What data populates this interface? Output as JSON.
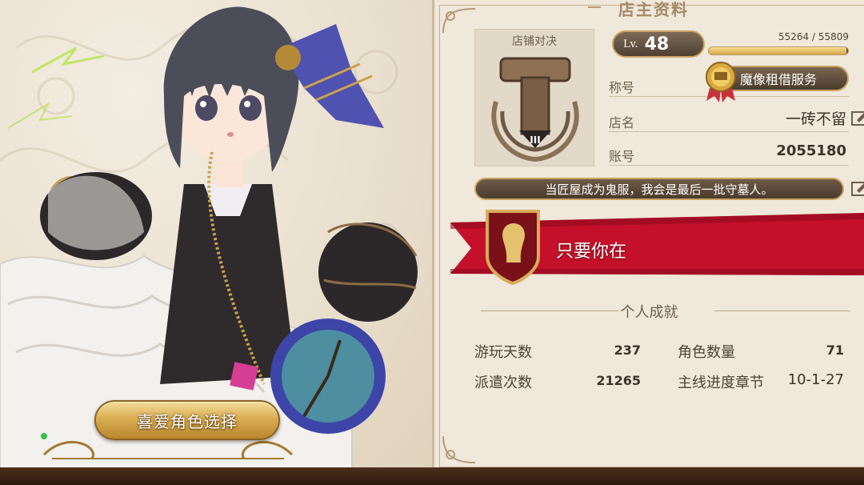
{
  "profile": {
    "panel_title": "店主资料",
    "card_title": "店铺对决",
    "rank_numeral": "III",
    "level_label": "Lv.",
    "level": "48",
    "exp_text": "55264 / 55809",
    "exp_fraction": 0.99,
    "title_label": "称号",
    "service_label": "魔像租借服务",
    "shop_name_label": "店名",
    "shop_name": "一砖不留",
    "account_label": "账号",
    "account": "2055180",
    "motto": "当匠屋成为鬼服，我会是最后一批守墓人。",
    "ribbon_text": "只要你在"
  },
  "achievements": {
    "section_title": "个人成就",
    "stats": [
      {
        "label": "游玩天数",
        "value": "237"
      },
      {
        "label": "角色数量",
        "value": "71"
      },
      {
        "label": "派遣次数",
        "value": "21265"
      },
      {
        "label": "主线进度章节",
        "value": "10-1-27"
      }
    ]
  },
  "left": {
    "favorite_button_label": "喜爱角色选择"
  },
  "colors": {
    "accent_gold": "#c9a563",
    "ribbon_red": "#c8102e",
    "panel_bg": "#efe8db",
    "badge_dark": "#4e4032"
  }
}
